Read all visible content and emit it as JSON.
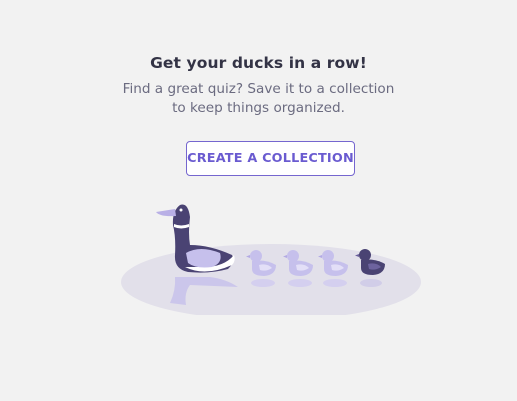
{
  "empty_state": {
    "heading": "Get your ducks in a row!",
    "subtext": "Find a great quiz? Save it to a collection to keep things organized.",
    "cta_label": "CREATE A COLLECTION"
  },
  "illustration": {
    "icon": "ducks-in-a-row-illustration",
    "colors": {
      "pond": "#e2e0ea",
      "mother_duck": "#4a4373",
      "duckling": "#c6c0ec",
      "dark_duckling": "#4a4373",
      "wing": "#b9b0e6",
      "reflection": "#c8c2ec",
      "accent": "#7566cf"
    }
  }
}
